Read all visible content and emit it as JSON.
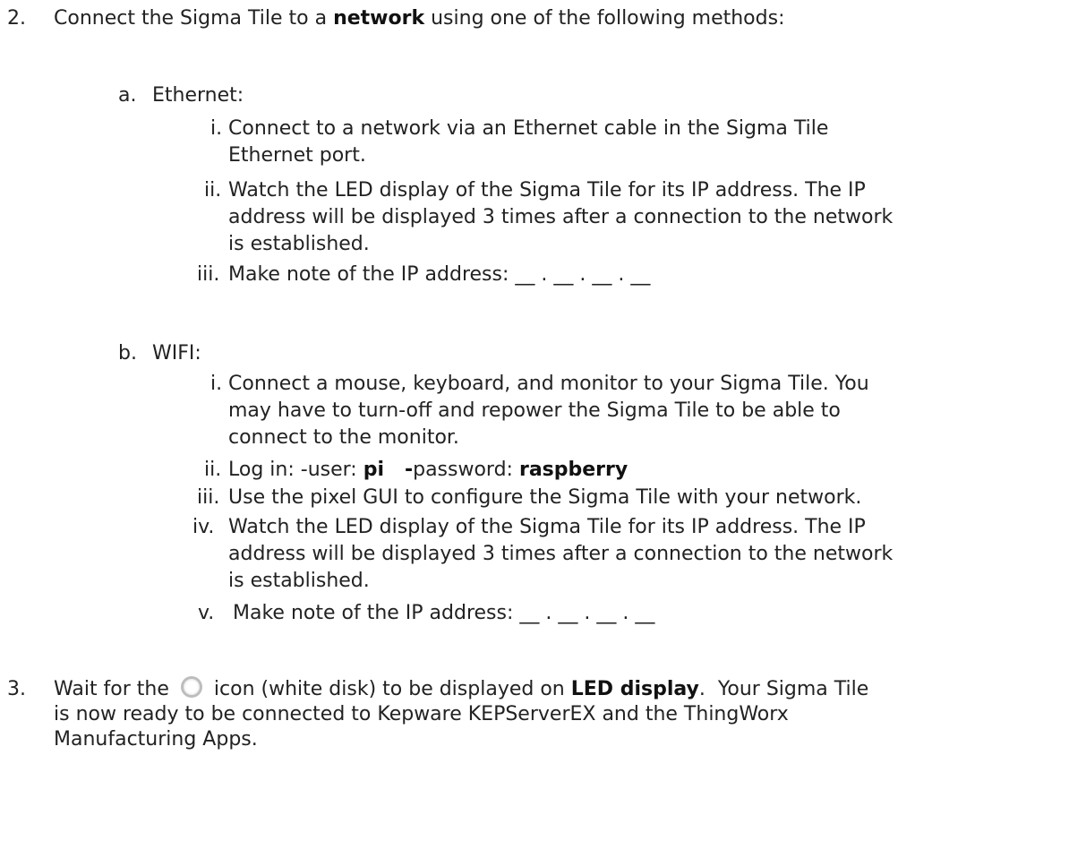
{
  "step2": {
    "number": "2.",
    "text_before": "Connect the Sigma Tile to a ",
    "bold": "network",
    "text_after": " using one of the following methods:"
  },
  "ethernet": {
    "letter": "a.",
    "title": "Ethernet:",
    "items": [
      {
        "num": "i.",
        "lines": [
          "Connect to a network via an Ethernet cable in the Sigma Tile",
          "Ethernet port."
        ]
      },
      {
        "num": "ii.",
        "lines": [
          "Watch the LED display of the Sigma Tile for its IP address. The IP",
          "address will be displayed 3 times after a connection to the network",
          "is established."
        ]
      },
      {
        "num": "iii.",
        "lines": [
          "Make note of the IP address:  __ . __ . __ . __"
        ]
      }
    ]
  },
  "wifi": {
    "letter": "b.",
    "title": "WIFI:",
    "item1": {
      "num": "i.",
      "lines": [
        "Connect a mouse, keyboard, and monitor to your Sigma Tile. You",
        "may have to turn-off and repower the Sigma Tile to be able to",
        "connect to the monitor."
      ]
    },
    "item2": {
      "num": "ii.",
      "prefix": "Log in:  -user: ",
      "user": "pi",
      "sep": "   -",
      "pw_label": "password: ",
      "password": "raspberry"
    },
    "item3": {
      "num": "iii.",
      "lines": [
        "Use the pixel GUI to configure the Sigma Tile with your network."
      ]
    },
    "item4": {
      "num": "iv.",
      "lines": [
        "Watch the LED display of the Sigma Tile for its IP address. The IP",
        "address will be displayed 3 times after a connection to the network",
        "is established."
      ]
    },
    "item5": {
      "num": "v.",
      "lines": [
        "Make note of the IP address:  __ . __ . __ . __"
      ]
    }
  },
  "step3": {
    "number": "3.",
    "text_before": "Wait for the ",
    "icon": "white-disk-icon",
    "text_mid": " icon (white disk) to be displayed on ",
    "bold": "LED display",
    "text_after": ".  Your Sigma Tile",
    "line2": "is now ready to be connected to Kepware KEPServerEX and the ThingWorx",
    "line3": "Manufacturing Apps."
  }
}
